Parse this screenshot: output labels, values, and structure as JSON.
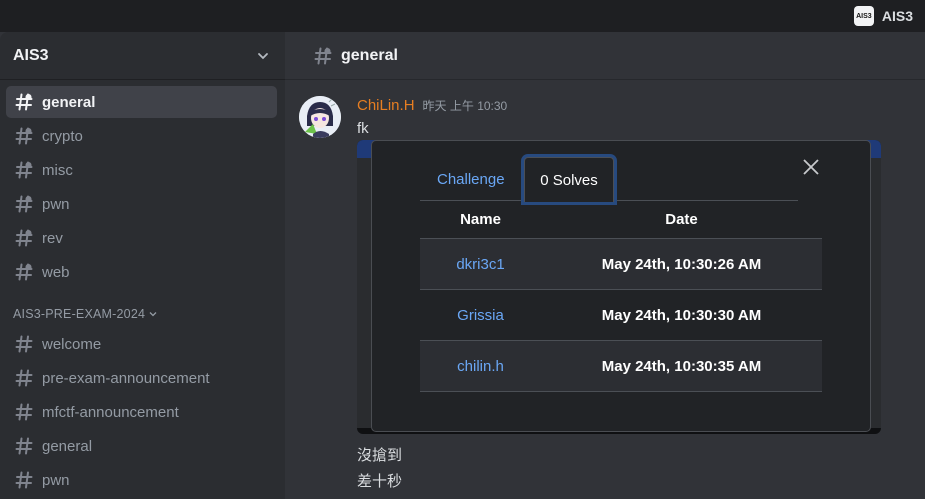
{
  "titlebar": {
    "server_tag": "AIS3",
    "server_icon_text": "AIS3"
  },
  "sidebar": {
    "server_name": "AIS3",
    "channels": [
      {
        "label": "general",
        "active": true
      },
      {
        "label": "crypto"
      },
      {
        "label": "misc"
      },
      {
        "label": "pwn"
      },
      {
        "label": "rev"
      },
      {
        "label": "web"
      }
    ],
    "category": "AIS3-PRE-EXAM-2024",
    "category_channels": [
      {
        "label": "welcome"
      },
      {
        "label": "pre-exam-announcement"
      },
      {
        "label": "mfctf-announcement"
      },
      {
        "label": "general"
      },
      {
        "label": "pwn"
      }
    ]
  },
  "header": {
    "channel": "general"
  },
  "message": {
    "author": "ChiLin.H",
    "author_color": "#e67e22",
    "timestamp": "昨天 上午 10:30",
    "text": "fk",
    "followups": [
      "沒搶到",
      "差十秒"
    ]
  },
  "embed": {
    "tabs": [
      "Challenge",
      "0 Solves"
    ],
    "active_tab": "0 Solves",
    "columns": [
      "Name",
      "Date"
    ],
    "rows": [
      {
        "name": "dkri3c1",
        "date": "May 24th, 10:30:26 AM"
      },
      {
        "name": "Grissia",
        "date": "May 24th, 10:30:30 AM"
      },
      {
        "name": "chilin.h",
        "date": "May 24th, 10:30:35 AM"
      }
    ]
  }
}
